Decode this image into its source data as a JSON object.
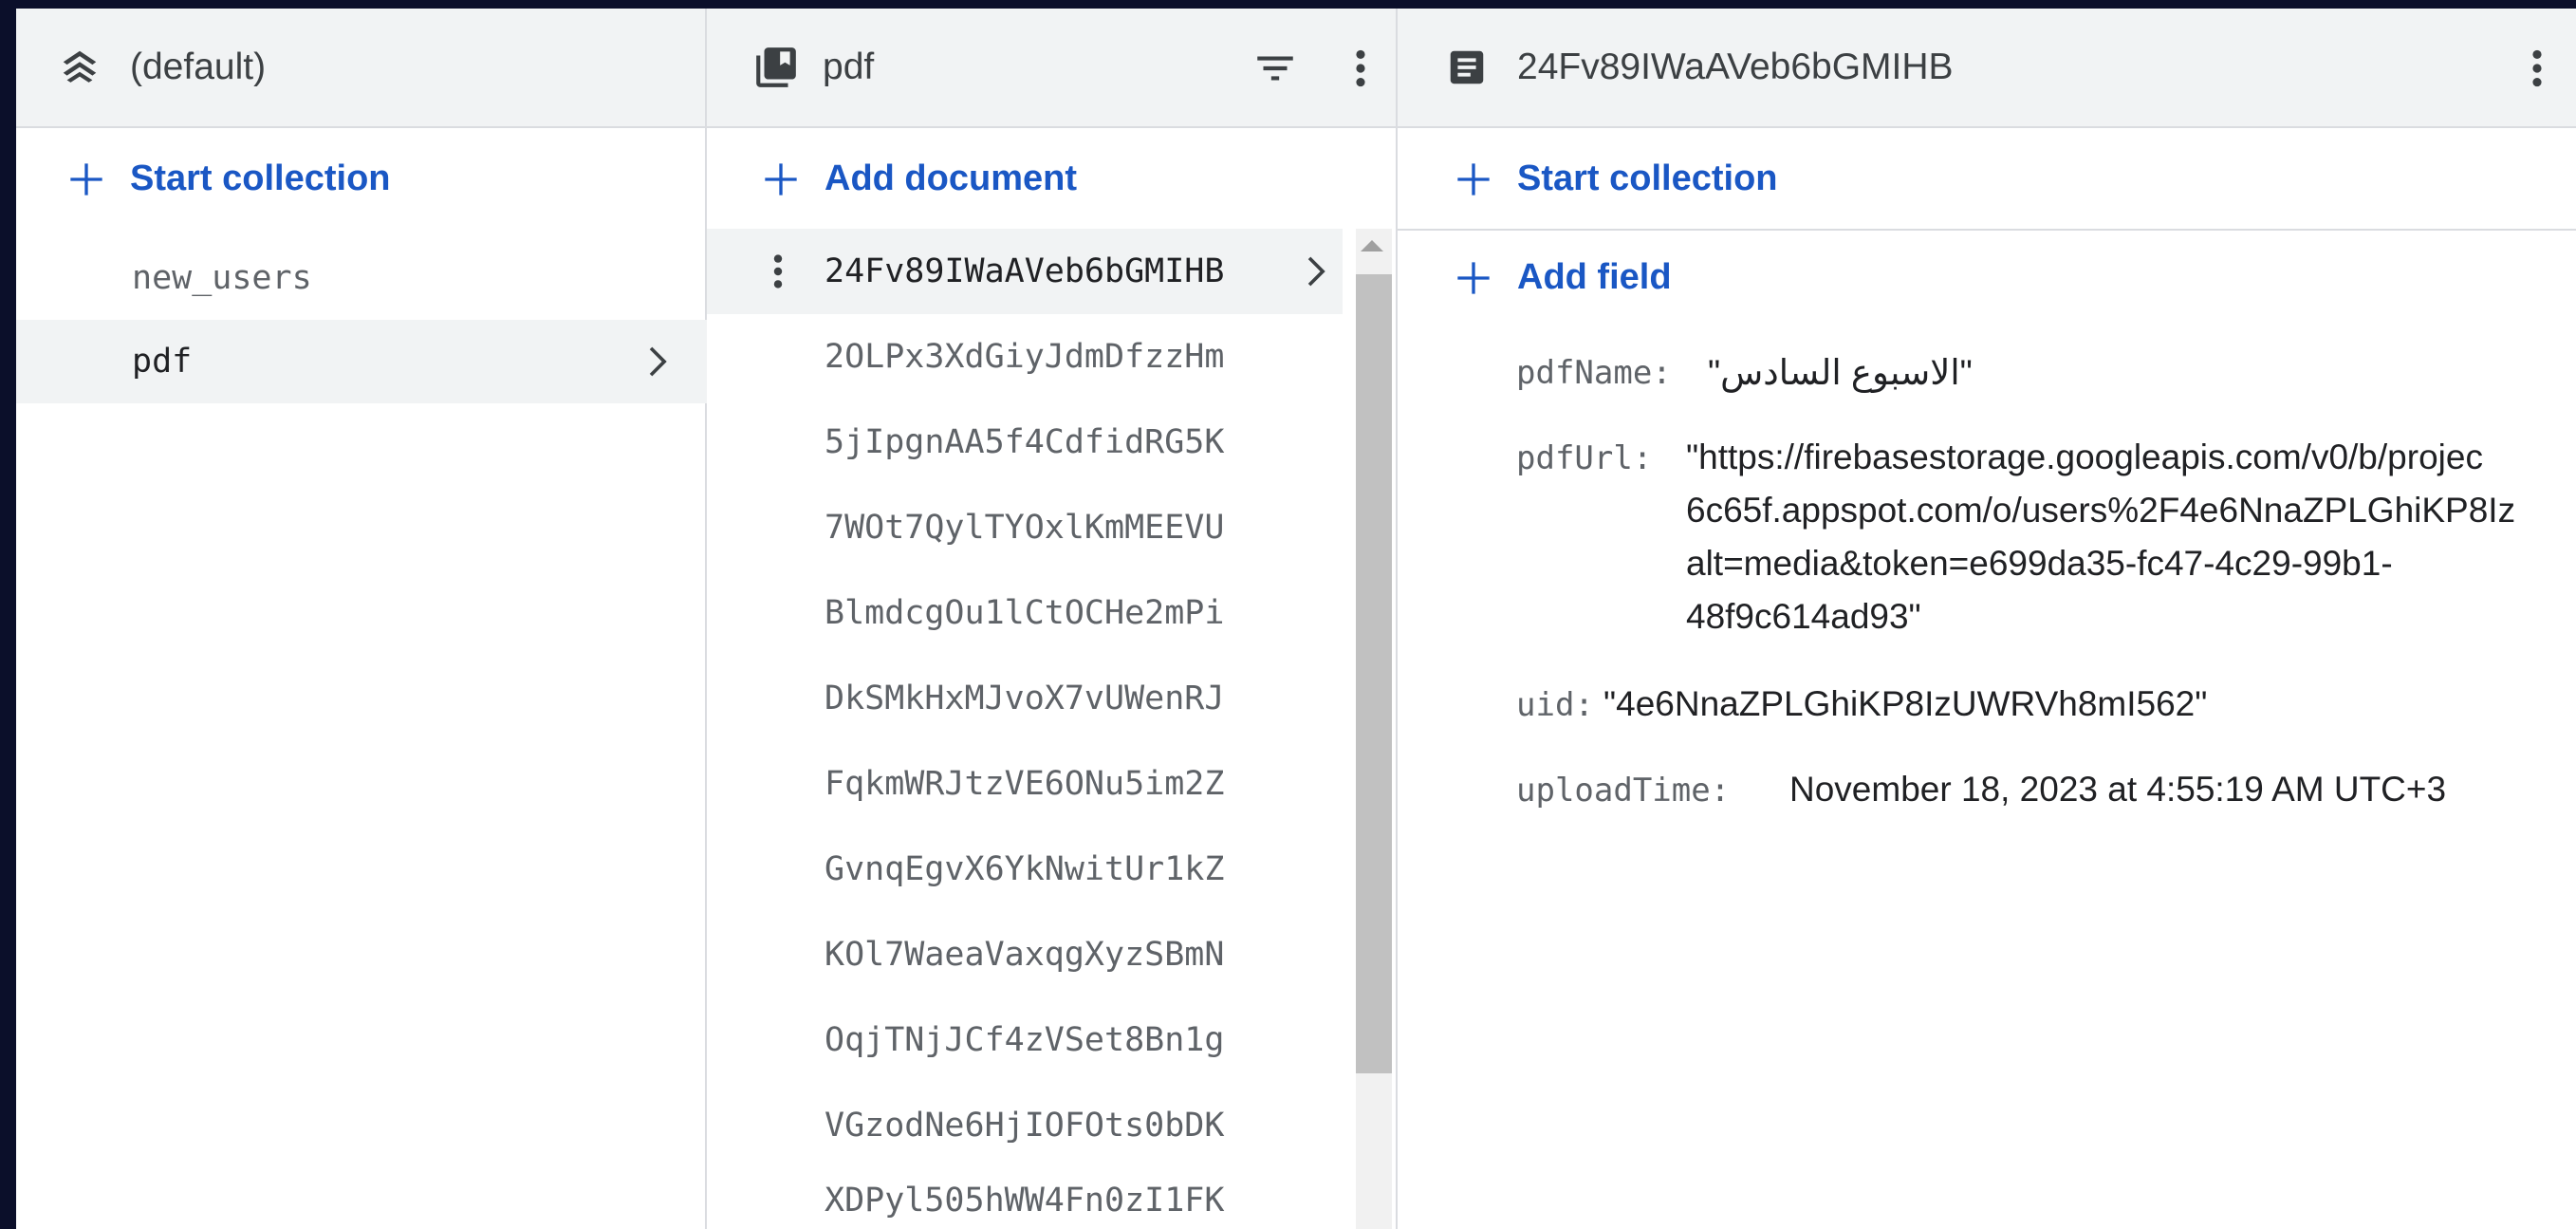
{
  "databases": {
    "title": "(default)",
    "start_collection": "Start collection",
    "collections": [
      {
        "label": "new_users"
      },
      {
        "label": "pdf"
      }
    ]
  },
  "collection_panel": {
    "title": "pdf",
    "add_document": "Add document",
    "documents": [
      "24Fv89IWaAVeb6bGMIHB",
      "2OLPx3XdGiyJdmDfzzHm",
      "5jIpgnAA5f4CdfidRG5K",
      "7WOt7QylTYOxlKmMEEVU",
      "BlmdcgOu1lCtOCHe2mPi",
      "DkSMkHxMJvoX7vUWenRJ",
      "FqkmWRJtzVE6ONu5im2Z",
      "GvnqEgvX6YkNwitUr1kZ",
      "KOl7WaeaVaxqgXyzSBmN",
      "OqjTNjJCf4zVSet8Bn1g",
      "VGzodNe6HjIOFOts0bDK",
      "XDPyl505hWW4Fn0zI1FK"
    ]
  },
  "document_panel": {
    "title": "24Fv89IWaAVeb6bGMIHB",
    "start_collection": "Start collection",
    "add_field": "Add field",
    "fields": {
      "pdfName": {
        "key": "pdfName:",
        "value": "\"الاسبوع السادس\""
      },
      "pdfUrl": {
        "key": "pdfUrl:",
        "lines": [
          "\"https://firebasestorage.googleapis.com/v0/b/projec",
          "6c65f.appspot.com/o/users%2F4e6NnaZPLGhiKP8Iz",
          "alt=media&token=e699da35-fc47-4c29-99b1-",
          "48f9c614ad93\""
        ]
      },
      "uid": {
        "key": "uid:",
        "value": "\"4e6NnaZPLGhiKP8IzUWRVh8mI562\""
      },
      "uploadTime": {
        "key": "uploadTime:",
        "value": "November 18, 2023 at 4:55:19 AM UTC+3"
      }
    }
  },
  "colors": {
    "accent": "#1a57c4",
    "header_bg": "#f1f3f4",
    "selected_bg": "#f1f3f4",
    "frame_bg": "#0b0f2a"
  },
  "icons": {
    "databases": "stacked-chevrons-icon",
    "collection": "library-books-icon",
    "document": "description-icon",
    "filter": "filter-list-icon",
    "more": "more-vert-icon",
    "add": "add-icon",
    "chevron": "chevron-right-icon"
  }
}
